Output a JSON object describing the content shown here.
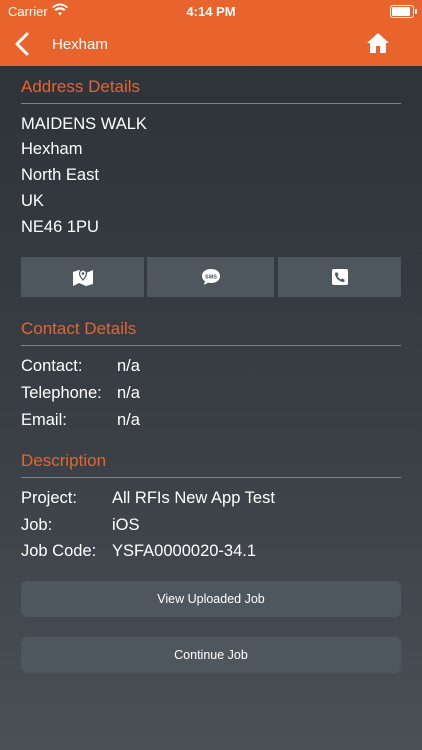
{
  "status_bar": {
    "carrier": "Carrier",
    "time": "4:14 PM"
  },
  "nav": {
    "title": "Hexham"
  },
  "address": {
    "heading": "Address Details",
    "lines": [
      "MAIDENS WALK",
      "Hexham",
      "North East",
      "UK",
      "NE46 1PU"
    ]
  },
  "actions": {
    "map_icon": "map-icon",
    "sms_icon": "sms-icon",
    "sms_text": "SMS",
    "phone_icon": "phone-icon"
  },
  "contact": {
    "heading": "Contact Details",
    "contact_label": "Contact:",
    "contact_value": "n/a",
    "telephone_label": "Telephone:",
    "telephone_value": "n/a",
    "email_label": "Email:",
    "email_value": "n/a"
  },
  "description": {
    "heading": "Description",
    "project_label": "Project:",
    "project_value": "All RFIs New App Test",
    "job_label": "Job:",
    "job_value": "iOS",
    "job_code_label": "Job Code:",
    "job_code_value": "YSFA0000020-34.1"
  },
  "buttons": {
    "view_uploaded": "View Uploaded Job",
    "continue": "Continue Job"
  },
  "colors": {
    "accent": "#e8642c",
    "background": "#2b3137",
    "button": "#4f575e"
  }
}
